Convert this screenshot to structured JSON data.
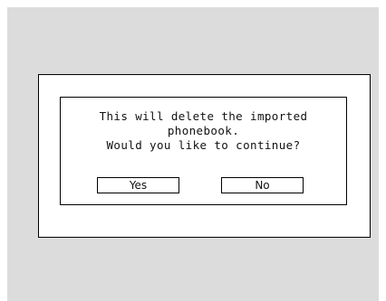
{
  "dialog": {
    "message_lines": [
      "This will delete the imported",
      "phonebook.",
      "Would you like to continue?"
    ],
    "yes_label": "Yes",
    "no_label": "No"
  }
}
